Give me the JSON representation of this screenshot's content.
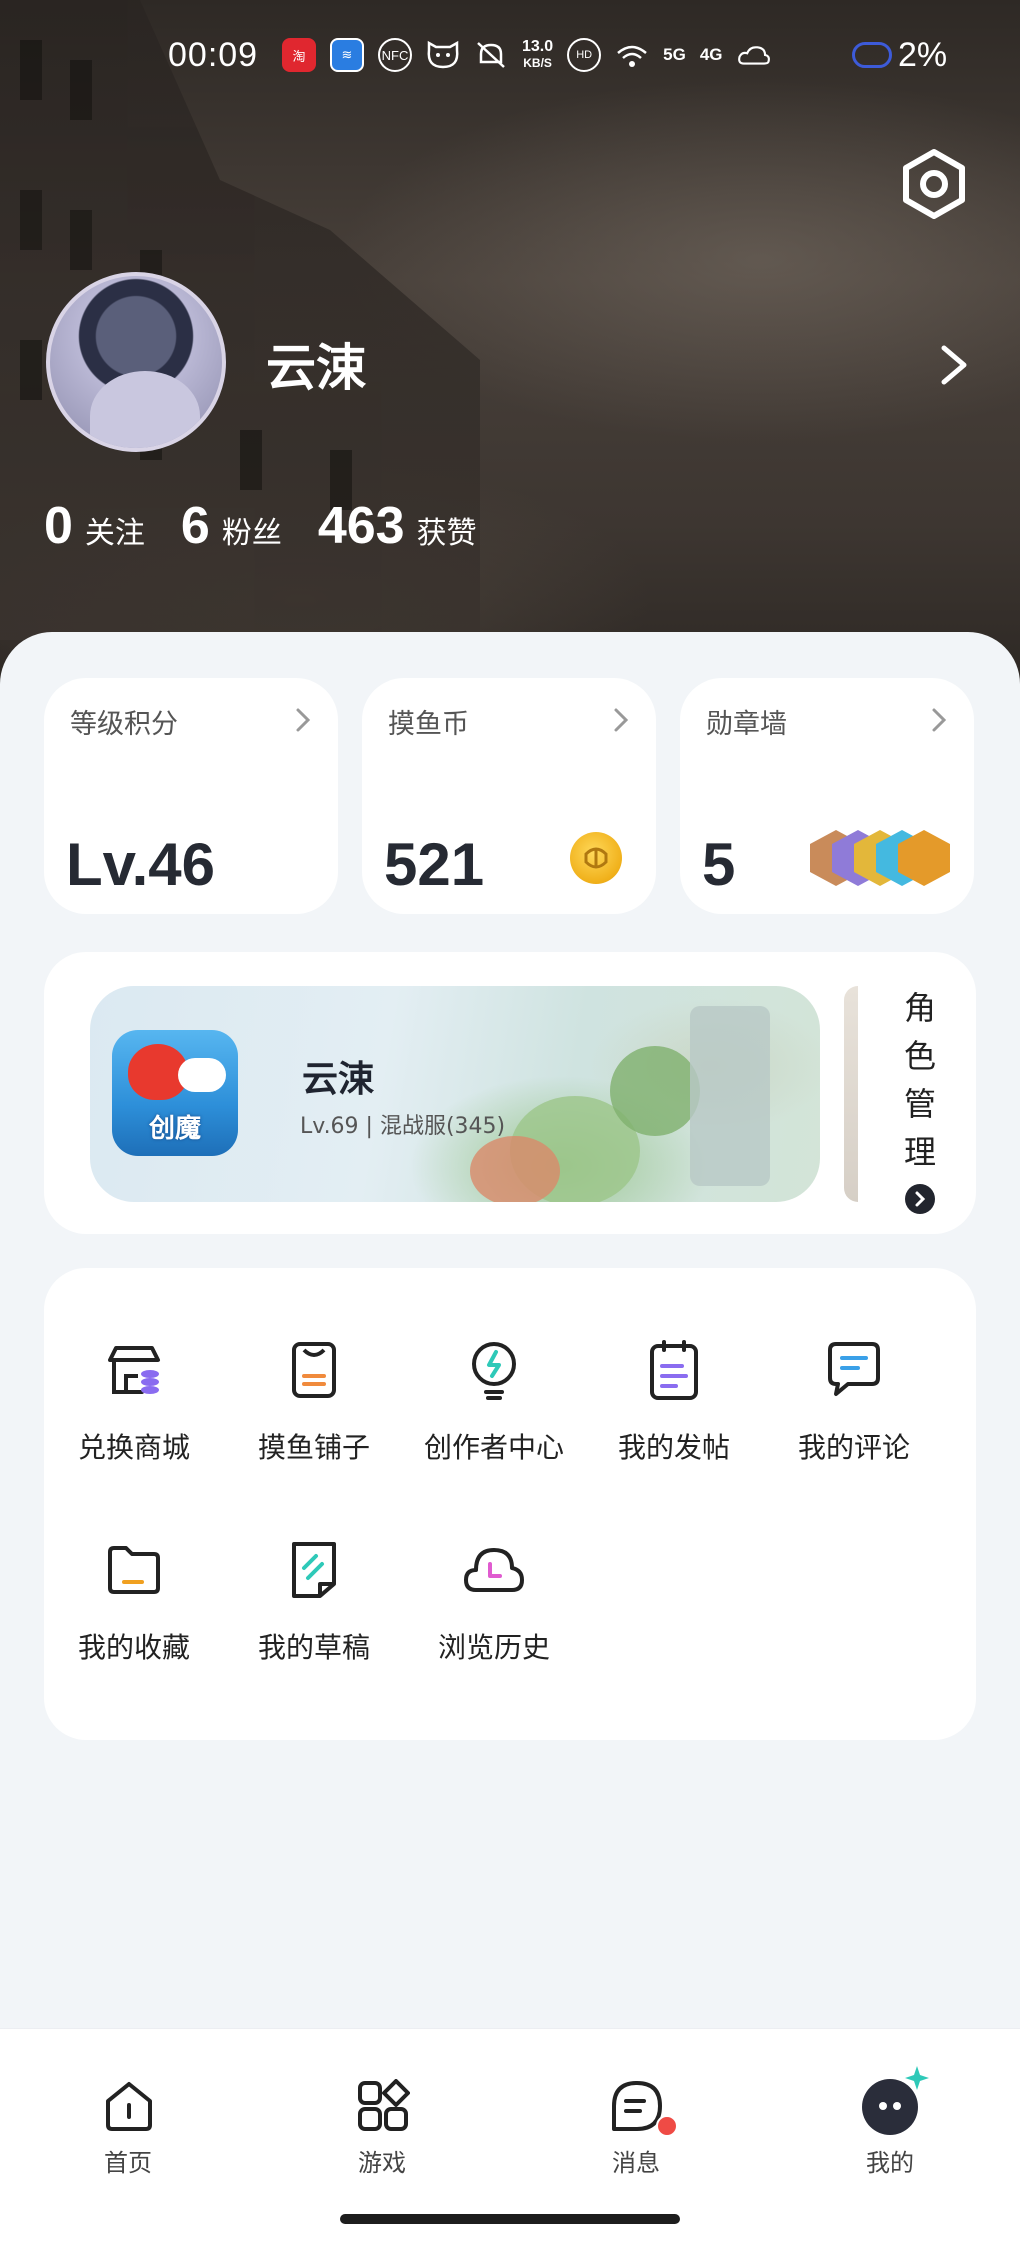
{
  "status_bar": {
    "time": "00:09",
    "app_icons": [
      "淘",
      "≋",
      "NFC"
    ],
    "speed_value": "13.0",
    "speed_unit": "KB/S",
    "network_1": "5G",
    "network_2": "4G",
    "battery": "2%"
  },
  "profile": {
    "username": "云涑",
    "following_count": "0",
    "following_label": "关注",
    "followers_count": "6",
    "followers_label": "粉丝",
    "likes_count": "463",
    "likes_label": "获赞"
  },
  "tiles": [
    {
      "label": "等级积分",
      "value": "Lv.46"
    },
    {
      "label": "摸鱼币",
      "value": "521"
    },
    {
      "label": "勋章墙",
      "value": "5"
    }
  ],
  "game_card": {
    "icon_text": "创魔",
    "name": "云涑",
    "subtitle": "Lv.69 | 混战服(345)",
    "role_manage": [
      "角",
      "色",
      "管",
      "理"
    ]
  },
  "menu": [
    {
      "label": "兑换商城",
      "icon": "store-icon"
    },
    {
      "label": "摸鱼铺子",
      "icon": "shop-bag-icon"
    },
    {
      "label": "创作者中心",
      "icon": "lightbulb-icon"
    },
    {
      "label": "我的发帖",
      "icon": "clipboard-icon"
    },
    {
      "label": "我的评论",
      "icon": "comment-icon"
    },
    {
      "label": "我的收藏",
      "icon": "folder-icon"
    },
    {
      "label": "我的草稿",
      "icon": "draft-icon"
    },
    {
      "label": "浏览历史",
      "icon": "history-cloud-icon"
    }
  ],
  "bottom_nav": [
    {
      "label": "首页",
      "icon": "home-icon"
    },
    {
      "label": "游戏",
      "icon": "games-grid-icon"
    },
    {
      "label": "消息",
      "icon": "message-icon"
    },
    {
      "label": "我的",
      "icon": "me-icon"
    }
  ],
  "colors": {
    "accent_orange": "#f08a3c",
    "accent_cyan": "#2ec9b8",
    "accent_purple": "#8a6cf0",
    "accent_pink": "#e05bd0",
    "notification_red": "#ef4b45"
  }
}
